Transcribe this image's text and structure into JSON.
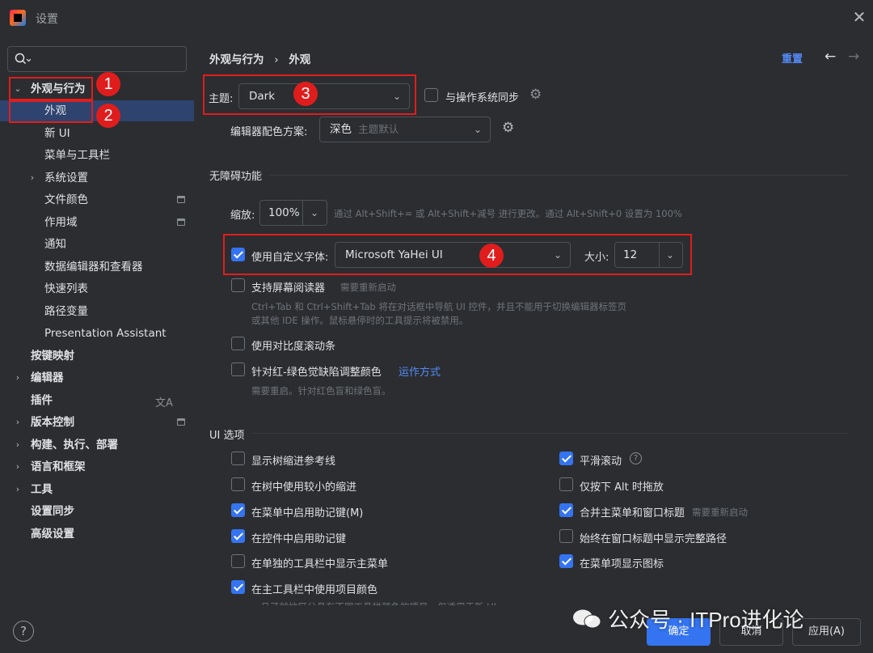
{
  "window": {
    "title": "设置",
    "close_glyph": "✕"
  },
  "search": {
    "placeholder": ""
  },
  "sidebar": {
    "items": [
      {
        "label": "外观与行为"
      },
      {
        "label": "外观"
      },
      {
        "label": "新 UI"
      },
      {
        "label": "菜单与工具栏"
      },
      {
        "label": "系统设置"
      },
      {
        "label": "文件颜色"
      },
      {
        "label": "作用域"
      },
      {
        "label": "通知"
      },
      {
        "label": "数据编辑器和查看器"
      },
      {
        "label": "快速列表"
      },
      {
        "label": "路径变量"
      },
      {
        "label": "Presentation Assistant"
      },
      {
        "label": "按键映射"
      },
      {
        "label": "编辑器"
      },
      {
        "label": "插件"
      },
      {
        "label": "版本控制"
      },
      {
        "label": "构建、执行、部署"
      },
      {
        "label": "语言和框架"
      },
      {
        "label": "工具"
      },
      {
        "label": "设置同步"
      },
      {
        "label": "高级设置"
      }
    ]
  },
  "header": {
    "breadcrumb_parent": "外观与行为",
    "breadcrumb_sep": "›",
    "breadcrumb_current": "外观",
    "reset_label": "重置",
    "back_glyph": "←",
    "forward_glyph": "→"
  },
  "theme": {
    "label": "主题:",
    "value": "Dark",
    "sync_label": "与操作系统同步"
  },
  "editor_scheme": {
    "label": "编辑器配色方案:",
    "value": "深色",
    "value_hint": "主题默认"
  },
  "accessibility": {
    "title": "无障碍功能"
  },
  "zoom": {
    "label": "缩放:",
    "value": "100%",
    "hint": "通过 Alt+Shift+= 或 Alt+Shift+减号 进行更改。通过 Alt+Shift+0 设置为 100%"
  },
  "custom_font": {
    "label": "使用自定义字体:",
    "value": "Microsoft YaHei UI",
    "size_label": "大小:",
    "size_value": "12"
  },
  "screen_reader": {
    "label": "支持屏幕阅读器",
    "badge": "需要重新启动",
    "desc1": "Ctrl+Tab 和 Ctrl+Shift+Tab 将在对话框中导航 UI 控件，并且不能用于切换编辑器标签页",
    "desc2": "或其他 IDE 操作。鼠标悬停时的工具提示将被禁用。"
  },
  "contrast_scroll": {
    "label": "使用对比度滚动条"
  },
  "color_blind": {
    "label": "针对红-绿色觉缺陷调整颜色",
    "link": "运作方式",
    "desc": "需要重启。针对红色盲和绿色盲。"
  },
  "ui_options": {
    "title": "UI 选项",
    "left": [
      {
        "label": "显示树缩进参考线",
        "checked": false
      },
      {
        "label": "在树中使用较小的缩进",
        "checked": false
      },
      {
        "label": "在菜单中启用助记键(M)",
        "checked": true
      },
      {
        "label": "在控件中启用助记键",
        "checked": true
      },
      {
        "label": "在单独的工具栏中显示主菜单",
        "checked": false
      },
      {
        "label": "在主工具栏中使用项目颜色",
        "checked": true
      }
    ],
    "right": [
      {
        "label": "平滑滚动",
        "checked": true
      },
      {
        "label": "仅按下 Alt 时拖放",
        "checked": false
      },
      {
        "label": "合并主菜单和窗口标题",
        "checked": true,
        "hint": "需要重新启动"
      },
      {
        "label": "始终在窗口标题中显示完整路径",
        "checked": false
      },
      {
        "label": "在菜单项显示图标",
        "checked": true
      }
    ],
    "cut_hint": "一旦了就地区分具有不同工具栏颜色的项目，仅适用于新 UI"
  },
  "annotations": [
    "1",
    "2",
    "3",
    "4"
  ],
  "footer": {
    "ok": "确定",
    "cancel": "取消",
    "apply": "应用(A)",
    "help": "?"
  },
  "watermark": {
    "text": "公众号 · ITPro进化论"
  },
  "colors": {
    "accent": "#3574f0",
    "selection": "#2e436e",
    "link": "#548af7",
    "annotation_red": "#e01d1d",
    "background": "#2b2d30"
  }
}
